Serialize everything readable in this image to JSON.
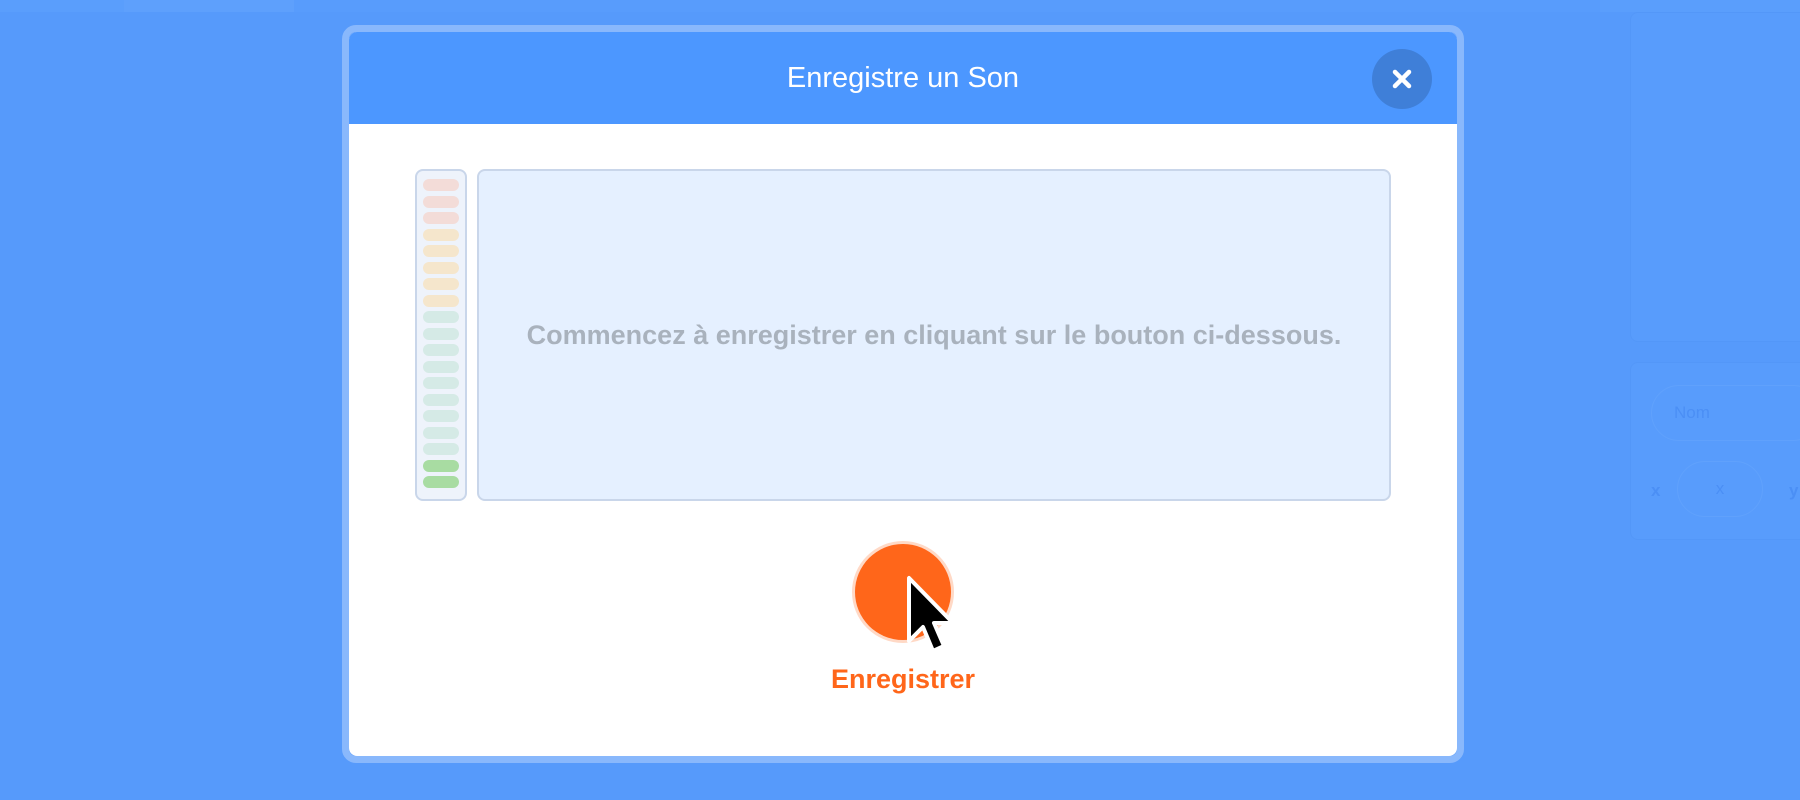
{
  "background": {
    "stage_panel": {},
    "sprite_info": {
      "name_placeholder": "Nom",
      "x_label": "x",
      "x_placeholder": "x",
      "y_label": "y"
    }
  },
  "modal": {
    "title": "Enregistre un Son",
    "close_icon": "close-icon",
    "instruction": "Commencez à enregistrer en cliquant sur le bouton ci-dessous.",
    "record_label": "Enregistrer"
  },
  "level_meter": {
    "bars": [
      {
        "color": "#f3dcd8"
      },
      {
        "color": "#f3dcd8"
      },
      {
        "color": "#f3dcd8"
      },
      {
        "color": "#f5e6cc"
      },
      {
        "color": "#f5e6cc"
      },
      {
        "color": "#f5e6cc"
      },
      {
        "color": "#f5e6cc"
      },
      {
        "color": "#f5e6cc"
      },
      {
        "color": "#d5eae6"
      },
      {
        "color": "#d5eae6"
      },
      {
        "color": "#d5eae6"
      },
      {
        "color": "#d5eae6"
      },
      {
        "color": "#d5eae6"
      },
      {
        "color": "#d5eae6"
      },
      {
        "color": "#d5eae6"
      },
      {
        "color": "#d5eae6"
      },
      {
        "color": "#d5eae6"
      },
      {
        "color": "#a8dca2"
      },
      {
        "color": "#a8dca2"
      }
    ]
  },
  "colors": {
    "header": "#4c97ff",
    "record": "#ff661a",
    "backdrop": "#5b9bf9"
  }
}
